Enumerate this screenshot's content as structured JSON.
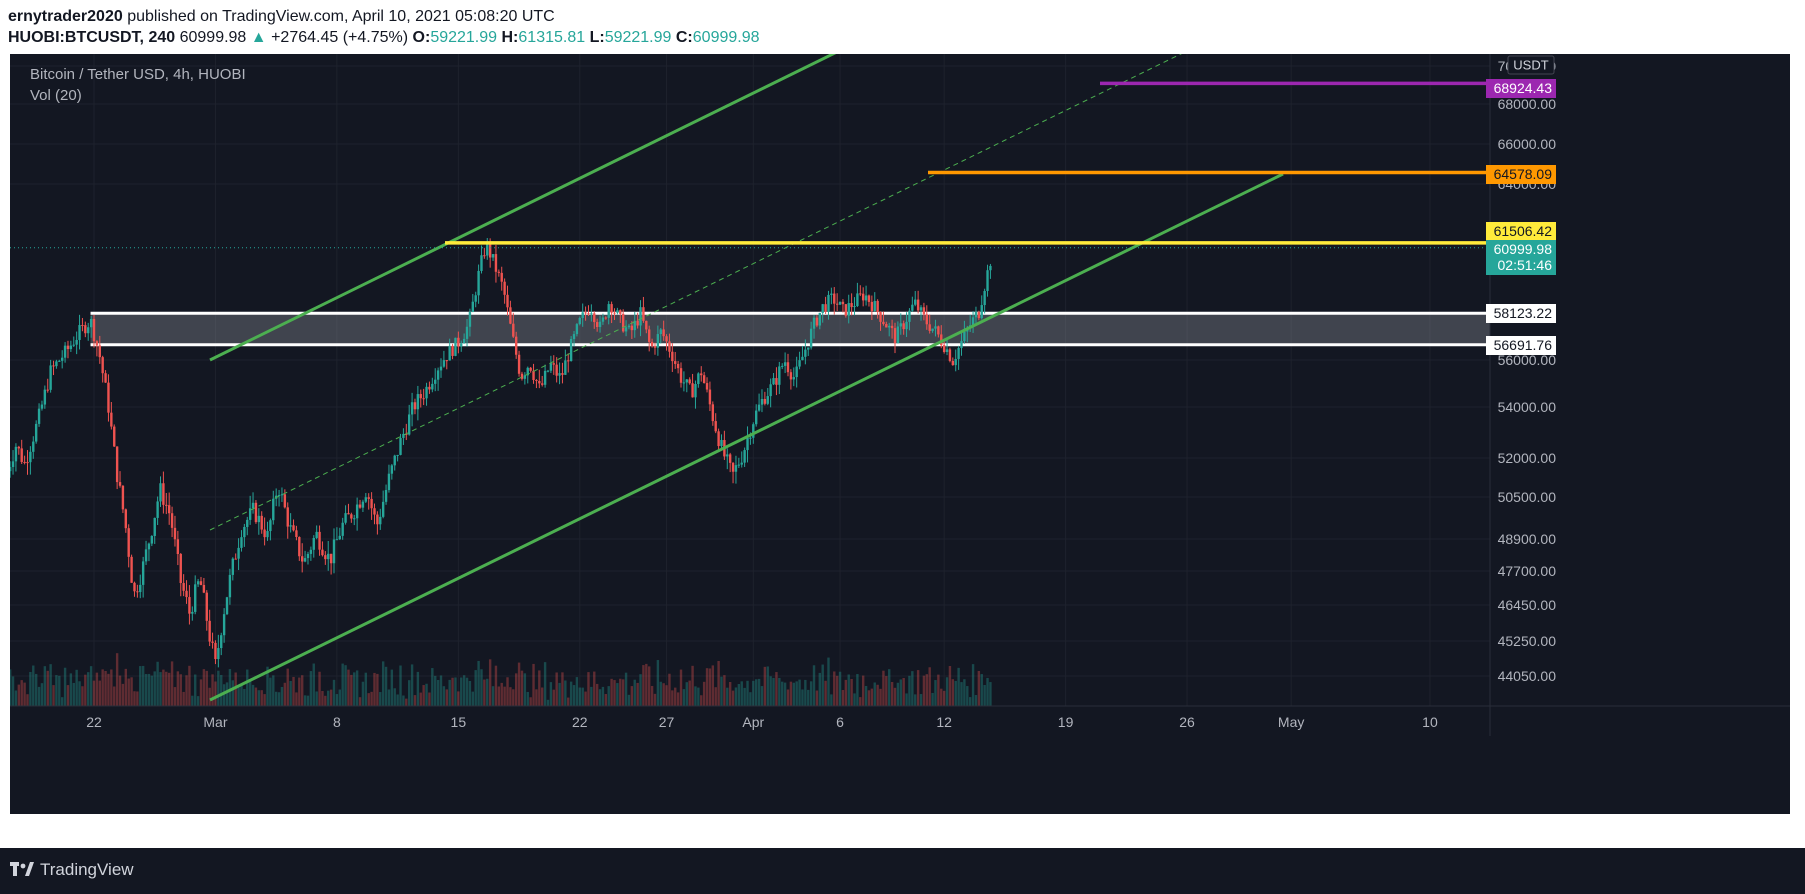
{
  "header": {
    "author": "ernytrader2020",
    "published_text": "published on TradingView.com, April 10, 2021 05:08:20 UTC",
    "symbol": "HUOBI:BTCUSDT, 240",
    "last": "60999.98",
    "change": "+2764.45 (+4.75%)",
    "open_label": "O:",
    "open": "59221.99",
    "high_label": "H:",
    "high": "61315.81",
    "low_label": "L:",
    "low": "59221.99",
    "close_label": "C:",
    "close": "60999.98"
  },
  "legend": {
    "title": "Bitcoin / Tether USD, 4h, HUOBI",
    "volume": "Vol (20)"
  },
  "footer": {
    "brand": "TradingView"
  },
  "chart_data": {
    "type": "candlestick",
    "currency_label": "USDT",
    "x_tick_labels": [
      "22",
      "Mar",
      "8",
      "15",
      "22",
      "27",
      "Apr",
      "6",
      "12",
      "19",
      "26",
      "May",
      "10"
    ],
    "y_tick_labels": [
      "70000.00",
      "68000.00",
      "66000.00",
      "64000.00",
      "56000.00",
      "54000.00",
      "52000.00",
      "50500.00",
      "48900.00",
      "47700.00",
      "46450.00",
      "45250.00",
      "44050.00"
    ],
    "price_labels": [
      {
        "value": "68924.43",
        "color": "#9c27b0"
      },
      {
        "value": "64578.09",
        "color": "#ff9800"
      },
      {
        "value": "61506.42",
        "color": "#ffeb3b"
      },
      {
        "value": "60999.98",
        "color": "#26a69a"
      },
      {
        "value": "58123.22",
        "color": "#ffffff"
      },
      {
        "value": "56691.76",
        "color": "#ffffff"
      }
    ],
    "countdown": "02:51:46",
    "horizontal_levels": [
      {
        "price": 68924.43,
        "color": "#9c27b0"
      },
      {
        "price": 64578.09,
        "color": "#ff9800"
      },
      {
        "price": 61506.42,
        "color": "#ffeb3b"
      }
    ],
    "zone": {
      "from": 56691.76,
      "to": 58123.22
    },
    "channel_lines": "ascending channel (green) with dashed midline",
    "colors": {
      "up": "#26a69a",
      "down": "#ef5350",
      "channel": "#4caf50",
      "background": "#131722"
    }
  }
}
